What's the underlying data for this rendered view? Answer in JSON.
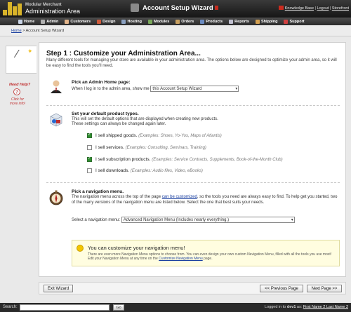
{
  "header": {
    "brand_line1": "Modular Merchant",
    "brand_line2": "Administration Area",
    "wizard_title": "Account Setup Wizard",
    "links": [
      "Knowledge Base",
      "Logout",
      "Storefront"
    ],
    "link_sep": " | "
  },
  "nav": [
    "Home",
    "Admin",
    "Customers",
    "Design",
    "Hosting",
    "Modules",
    "Orders",
    "Products",
    "Reports",
    "Shipping",
    "Support"
  ],
  "breadcrumb": {
    "home": "Home",
    "sep": " > ",
    "current": "Account Setup Wizard"
  },
  "sidebar": {
    "need_help": "Need Help?",
    "click_help": "Click for more info!"
  },
  "step": {
    "title": "Step 1 : Customize your Administration Area...",
    "desc": "Many different tools for managing your store are available in your administration area. The options below are designed to optimize your admin area, so it will be easy to find the tools you'll need."
  },
  "home_page": {
    "title": "Pick an Admin Home page:",
    "prompt": "When I log in to the admin area, show me",
    "selected": "this Account Setup Wizard"
  },
  "product_types": {
    "title": "Set your default product types.",
    "desc1": "This will set the default options that are displayed when creating new products.",
    "desc2": "These settings can always be changed again later.",
    "options": [
      {
        "label": "I sell shipped goods.",
        "example": "(Examples: Shoes, Yo-Yos, Maps of Atlantis)",
        "checked": true
      },
      {
        "label": "I sell services.",
        "example": "(Examples: Consulting, Seminars, Training)",
        "checked": false
      },
      {
        "label": "I sell subscription products.",
        "example": "(Examples: Service Contracts, Supplements, Book-of-the-Month Club)",
        "checked": true
      },
      {
        "label": "I sell downloads.",
        "example": "(Examples: Audio files, Video, eBooks)",
        "checked": false
      }
    ]
  },
  "navigation": {
    "title": "Pick a navigation menu.",
    "desc_a": "The navigation menu across the top of the page ",
    "desc_link": "can be customized",
    "desc_b": ", so the tools you need are always easy to find. To help get you started, two of the many versions of the navigation menu are listed below. Select the one that best suits your needs.",
    "select_label": "Select a navigation menu:",
    "selected": "Advanced Navigation Menu (Includes nearly everything.)"
  },
  "tip": {
    "title": "You can customize your navigation menu!",
    "text": "There are even more Navigation Menu options to choose from. You can even design your own custom Navigation Menu, filled with all the tools you use most! Edit your Navigation Menu at any time on the ",
    "link": "Customize Navigation Menu",
    "text_end": " page."
  },
  "buttons": {
    "exit": "Exit Wizard",
    "prev": "<< Previous Page",
    "next": "Next Page >>"
  },
  "footer": {
    "search_label": "Search:",
    "go": "Go",
    "logged_in": "Logged in to ",
    "account": "dev1",
    "as": " as: ",
    "user": "First Name 2 Last Name 2"
  },
  "colors": {
    "topbar": "#1e1e1e",
    "accent_gold": "#d9b42a",
    "link": "#1a3fa0",
    "need_help": "#c03030",
    "tip_bg": "#fffde0"
  }
}
